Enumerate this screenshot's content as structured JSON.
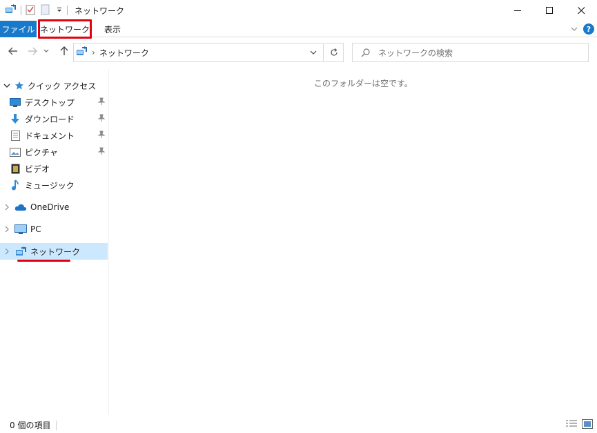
{
  "window": {
    "title": "ネットワーク"
  },
  "ribbon": {
    "tabs": [
      {
        "label": "ファイル"
      },
      {
        "label": "ネットワーク"
      },
      {
        "label": "表示"
      }
    ],
    "help_label": "?"
  },
  "address": {
    "path": "ネットワーク",
    "separator": "›"
  },
  "search": {
    "placeholder": "ネットワークの検索"
  },
  "navpane": {
    "quick_access": "クイック アクセス",
    "items": [
      {
        "label": "デスクトップ",
        "icon": "desktop-icon",
        "pinned": true
      },
      {
        "label": "ダウンロード",
        "icon": "download-icon",
        "pinned": true
      },
      {
        "label": "ドキュメント",
        "icon": "document-icon",
        "pinned": true
      },
      {
        "label": "ピクチャ",
        "icon": "pictures-icon",
        "pinned": true
      },
      {
        "label": "ビデオ",
        "icon": "video-icon",
        "pinned": false
      },
      {
        "label": "ミュージック",
        "icon": "music-icon",
        "pinned": false
      }
    ],
    "onedrive": "OneDrive",
    "pc": "PC",
    "network": "ネットワーク"
  },
  "content": {
    "empty_message": "このフォルダーは空です。"
  },
  "statusbar": {
    "item_count": "0 個の項目"
  },
  "colors": {
    "accent": "#1979ca",
    "highlight": "#e3000f",
    "selection": "#cce8ff"
  }
}
